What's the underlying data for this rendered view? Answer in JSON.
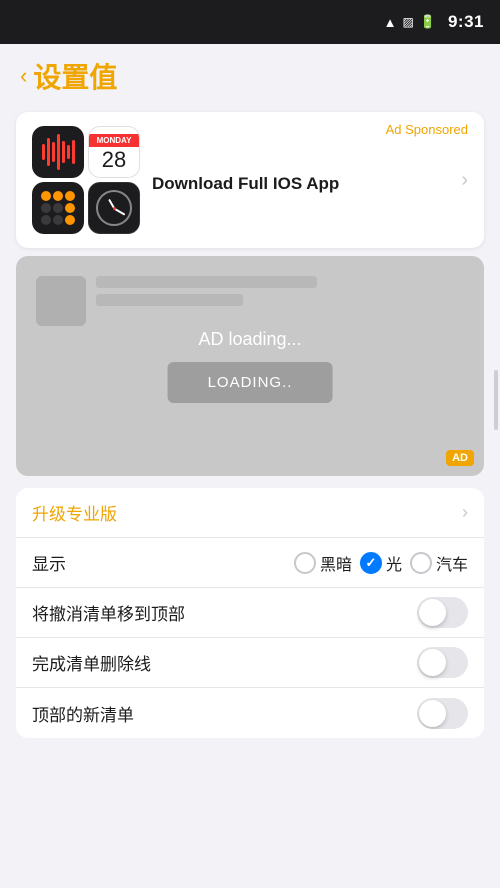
{
  "statusBar": {
    "time": "9:31"
  },
  "header": {
    "backLabel": "＜",
    "title": "设置值"
  },
  "adCard": {
    "sponsoredLabel": "Ad Sponsored",
    "downloadText": "Download Full IOS App",
    "calDay": "Monday",
    "calNumber": "28"
  },
  "adLoading": {
    "loadingText": "AD loading...",
    "buttonLabel": "LOADING..",
    "adBadge": "AD"
  },
  "settings": {
    "upgradeLabel": "升级专业版",
    "displayLabel": "显示",
    "displayOptions": [
      {
        "label": "黑暗",
        "selected": false
      },
      {
        "label": "光",
        "selected": true
      },
      {
        "label": "汽车",
        "selected": false
      }
    ],
    "row1Label": "将撤消清单移到顶部",
    "row2Label": "完成清单删除线",
    "row3Label": "顶部的新清单"
  }
}
